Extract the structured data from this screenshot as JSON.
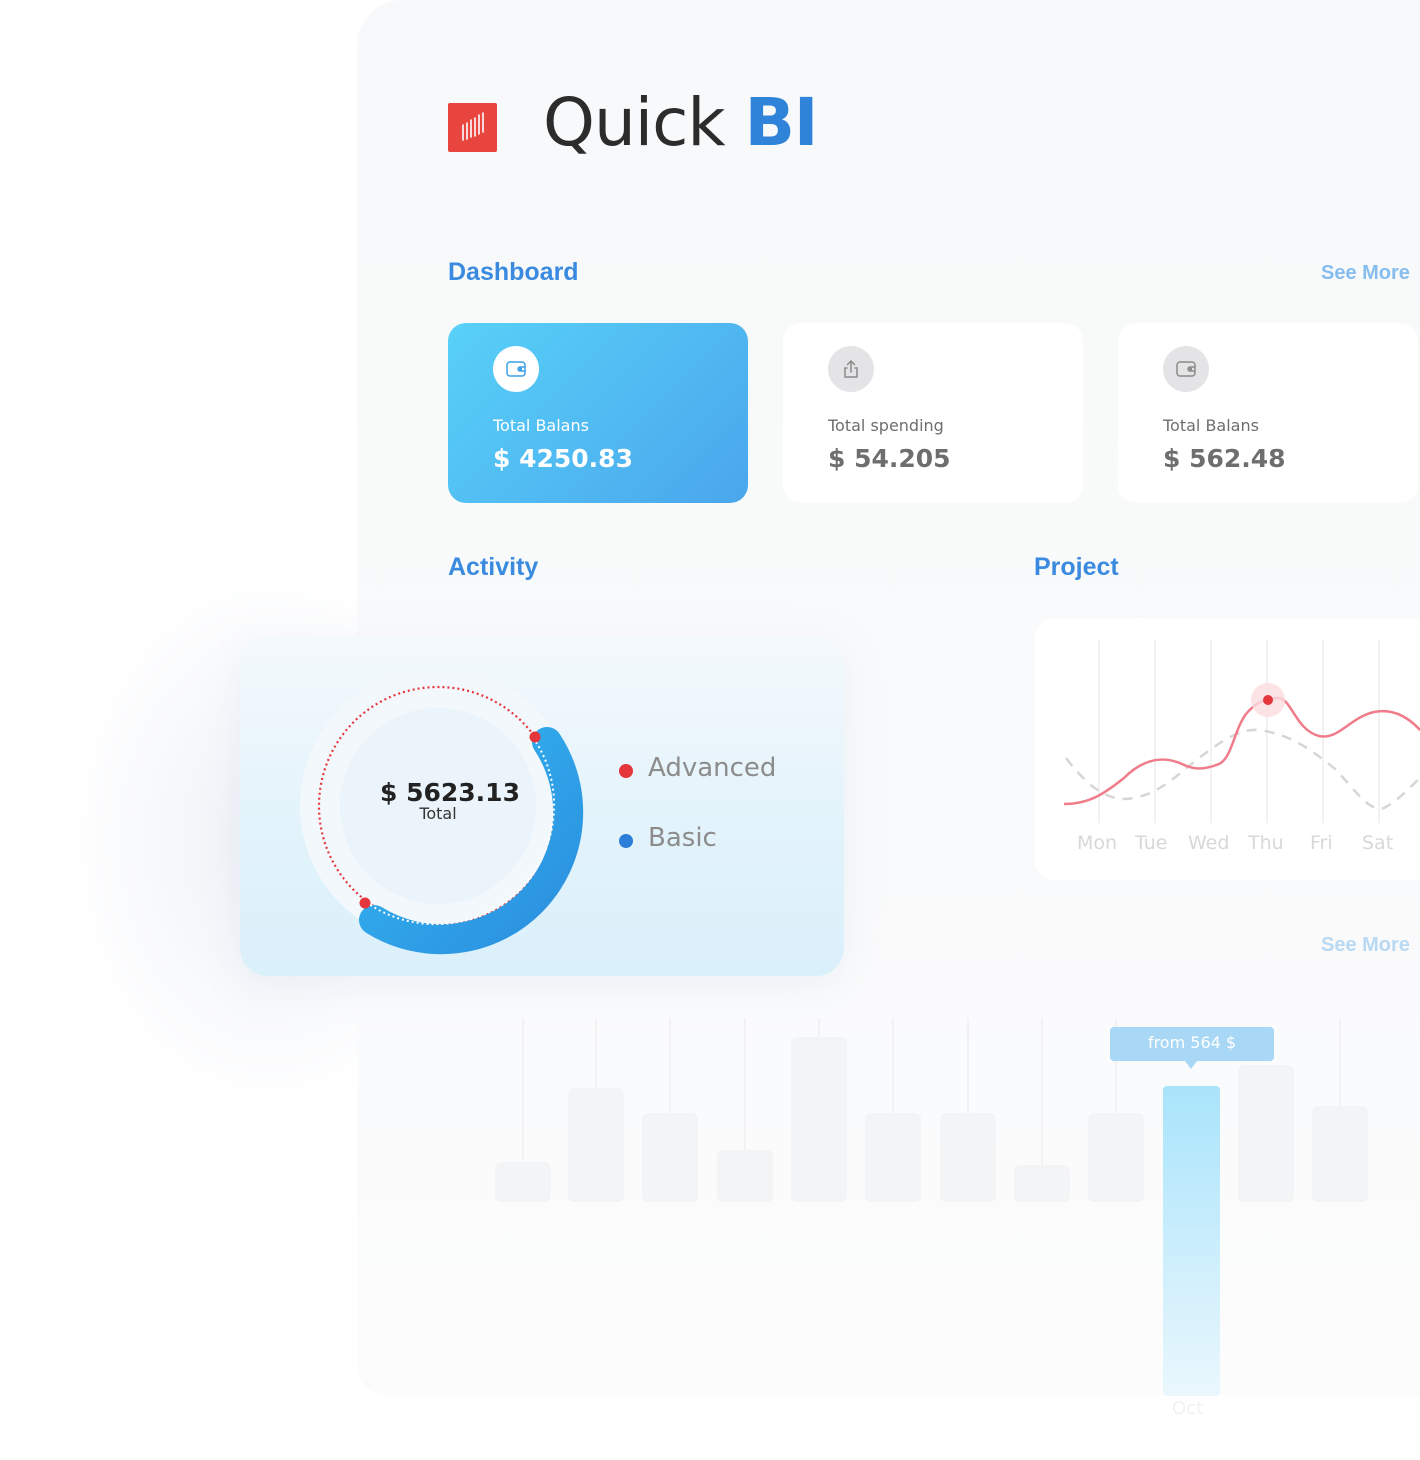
{
  "brand": {
    "name_part1": "Quick",
    "name_part2": "BI"
  },
  "dashboard": {
    "title": "Dashboard",
    "see_more": "See More",
    "cards": [
      {
        "label": "Total Balans",
        "value": "$ 4250.83",
        "icon": "wallet-icon",
        "active": true
      },
      {
        "label": "Total spending",
        "value": "$ 54.205",
        "icon": "share-icon",
        "active": false
      },
      {
        "label": "Total Balans",
        "value": "$ 562.48",
        "icon": "wallet-icon",
        "active": false
      }
    ]
  },
  "activity": {
    "title": "Activity",
    "total_value": "$ 5623.13",
    "total_label": "Total",
    "legend": [
      {
        "label": "Advanced",
        "color": "#e5363c"
      },
      {
        "label": "Basic",
        "color": "#2b7fd8"
      }
    ]
  },
  "project": {
    "title": "Project",
    "days": [
      "Mon",
      "Tue",
      "Wed",
      "Thu",
      "Fri",
      "Sat"
    ]
  },
  "bottom": {
    "see_more": "See More",
    "tooltip": "from 564 $",
    "month": "Oct"
  },
  "colors": {
    "accent": "#2f83d9",
    "logo": "#e8453e",
    "line": "#f07c8a"
  }
}
